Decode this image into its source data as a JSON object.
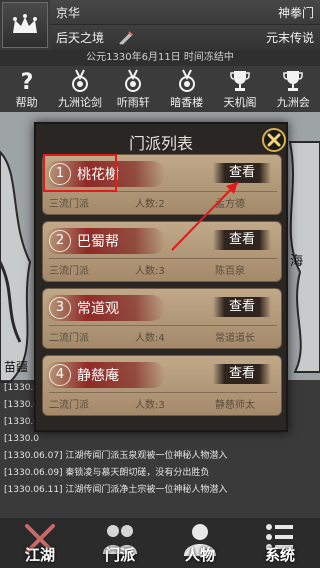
{
  "header": {
    "location": "京华",
    "skill": "神拳门",
    "rank": "后天之境",
    "legend": "元末传说",
    "time": "公元1330年6月11日 时间冻结中",
    "crown_icon": "crown-icon",
    "skill_icon": "swords-icon"
  },
  "nav": [
    {
      "label": "帮助",
      "icon": "question-icon"
    },
    {
      "label": "九洲论剑",
      "icon": "medal-icon"
    },
    {
      "label": "听雨轩",
      "icon": "medal-icon"
    },
    {
      "label": "暗香楼",
      "icon": "medal-icon"
    },
    {
      "label": "天机阁",
      "icon": "trophy-icon"
    },
    {
      "label": "九洲会",
      "icon": "trophy-icon"
    }
  ],
  "modal": {
    "title": "门派列表",
    "close_icon": "close-icon",
    "sects": [
      {
        "num": "1",
        "name": "桃花榭",
        "grade": "三流门派",
        "count": "人数:2",
        "leader": "孟方德",
        "action": "查看"
      },
      {
        "num": "2",
        "name": "巴蜀帮",
        "grade": "三流门派",
        "count": "人数:3",
        "leader": "陈百泉",
        "action": "查看"
      },
      {
        "num": "3",
        "name": "常道观",
        "grade": "二流门派",
        "count": "人数:4",
        "leader": "常道道长",
        "action": "查看"
      },
      {
        "num": "4",
        "name": "静慈庵",
        "grade": "二流门派",
        "count": "人数:3",
        "leader": "静慈师太",
        "action": "查看"
      }
    ]
  },
  "map": {
    "label_left": "苗疆",
    "label_right": "海"
  },
  "log": [
    "[1330.0",
    "[1330.0",
    "[1330.0",
    "[1330.0",
    "[1330.06.07] 江湖传闻门派玉泉观被一位神秘人物潜入",
    "[1330.06.09] 秦锁凌与慕天朗切磋，没有分出胜负",
    "[1330.06.11] 江湖传闻门派净土宗被一位神秘人物潜入"
  ],
  "tabs": [
    {
      "label": "江湖",
      "icon": "crossed-swords-icon"
    },
    {
      "label": "门派",
      "icon": "people-icon"
    },
    {
      "label": "人物",
      "icon": "person-icon"
    },
    {
      "label": "系统",
      "icon": "list-icon"
    }
  ]
}
